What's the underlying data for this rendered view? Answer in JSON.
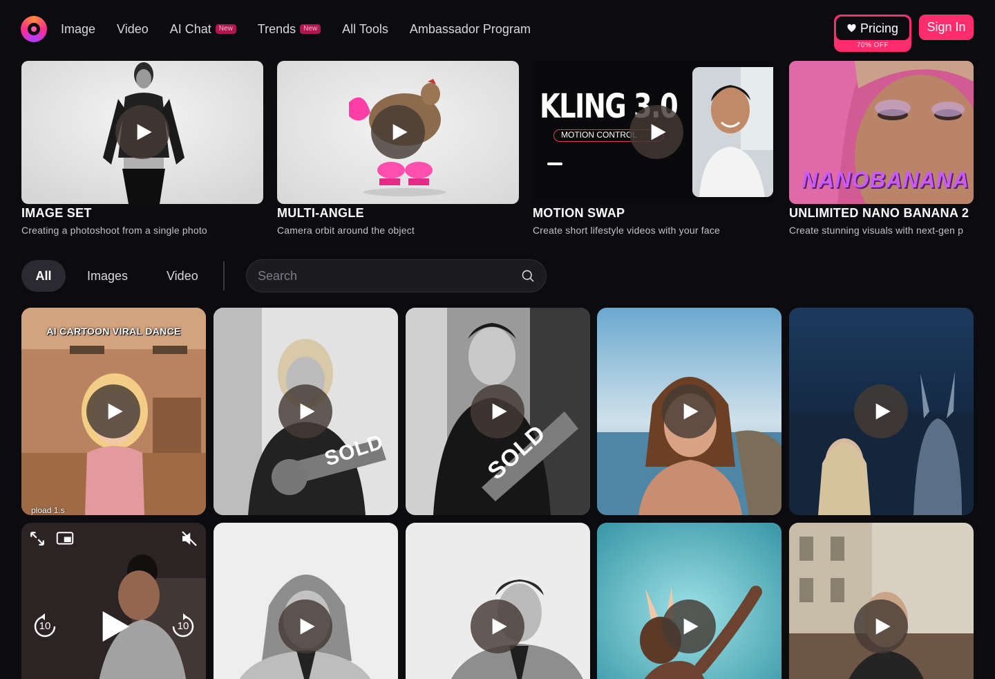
{
  "nav": {
    "links": [
      {
        "label": "Image"
      },
      {
        "label": "Video"
      },
      {
        "label": "AI Chat",
        "badge": "New"
      },
      {
        "label": "Trends",
        "badge": "New"
      },
      {
        "label": "All Tools"
      },
      {
        "label": "Ambassador Program"
      }
    ],
    "pricing_label": "Pricing",
    "pricing_badge": "70% OFF",
    "signin_label": "Sign In"
  },
  "featured": [
    {
      "title": "IMAGE SET",
      "description": "Creating a photoshoot from a single photo"
    },
    {
      "title": "MULTI-ANGLE",
      "description": "Camera orbit around the object"
    },
    {
      "title": "MOTION SWAP",
      "description": "Create short lifestyle videos with your face",
      "overlay_title": "KLING 3.0",
      "overlay_sub": "MOTION CONTROL"
    },
    {
      "title": "UNLIMITED NANO BANANA 2",
      "description": "Create stunning visuals with next-gen p",
      "overlay_title": "NANOBANANA"
    }
  ],
  "filters": {
    "chips": [
      "All",
      "Images",
      "Video"
    ],
    "active": "All",
    "search_placeholder": "Search"
  },
  "grid": {
    "cards": [
      {
        "caption": "AI CARTOON VIRAL DANCE",
        "footer": "pload 1.s"
      },
      {
        "badge": "SOLD"
      },
      {
        "badge": "SOLD"
      },
      {},
      {},
      {
        "video_controls": {
          "rewind": "10",
          "forward": "10"
        }
      },
      {},
      {},
      {},
      {}
    ]
  },
  "colors": {
    "background": "#0c0b10",
    "accent": "#ff2d6b",
    "chip_active": "#2a2a30",
    "search_bg": "#1b1b20"
  }
}
